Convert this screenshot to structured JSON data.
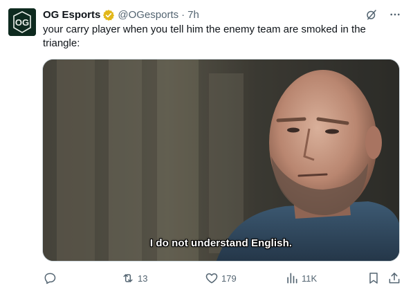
{
  "post": {
    "author_name": "OG Esports",
    "handle": "@OGesports",
    "separator": "·",
    "time": "7h",
    "text": "your carry player when you tell him the enemy team are smoked in the triangle:",
    "avatar_text": "OG"
  },
  "media": {
    "subtitle": "I do not understand English."
  },
  "actions": {
    "replies": "",
    "reposts": "13",
    "likes": "179",
    "views": "11K"
  },
  "icons": {
    "verified": "verified-badge-icon",
    "grok": "grok-icon",
    "more": "more-dots-icon",
    "reply": "reply-icon",
    "repost": "repost-icon",
    "like": "heart-icon",
    "views": "views-bar-chart-icon",
    "bookmark": "bookmark-icon",
    "share": "share-icon"
  },
  "colors": {
    "text": "#0f1419",
    "secondary": "#536471",
    "verified_gold": "#e2b719",
    "avatar_bg": "#0e2a1f"
  }
}
